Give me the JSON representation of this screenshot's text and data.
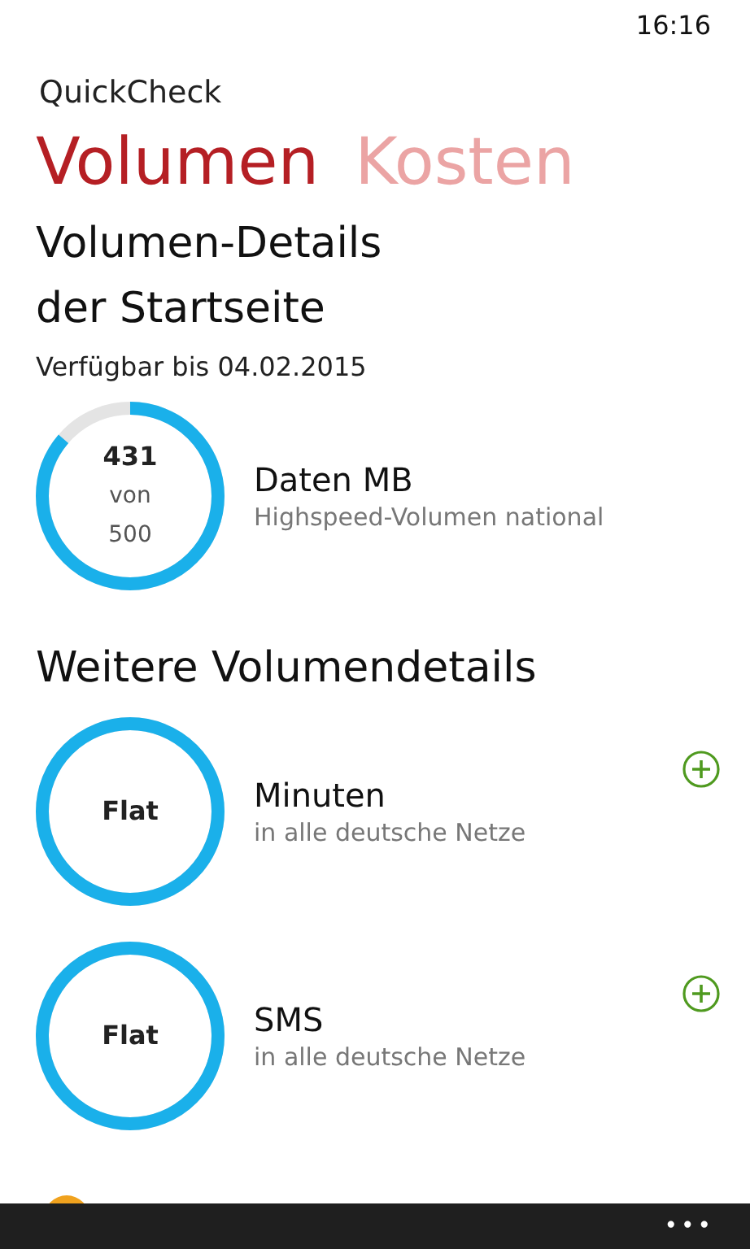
{
  "status_bar": {
    "time": "16:16"
  },
  "app_title": "QuickCheck",
  "pivots": [
    {
      "label": "Volumen",
      "selected": true
    },
    {
      "label": "Kosten",
      "selected": false
    }
  ],
  "heading_lines": [
    "Volumen-Details",
    "der Startseite"
  ],
  "valid_until": "Verfügbar bis 04.02.2015",
  "main_items": [
    {
      "kind": "counter",
      "center": [
        "431",
        "von",
        "500"
      ],
      "title": "Daten MB",
      "subtitle": "Highspeed-Volumen national",
      "has_add": false
    }
  ],
  "more_title": "Weitere Volumendetails",
  "more_items": [
    {
      "kind": "flat",
      "center": [
        "Flat"
      ],
      "title": "Minuten",
      "subtitle": "in alle deutsche Netze",
      "has_add": true
    },
    {
      "kind": "flat",
      "center": [
        "Flat"
      ],
      "title": "SMS",
      "subtitle": "in alle deutsche Netze",
      "has_add": true
    }
  ],
  "app_bar": {
    "menu": "•••"
  }
}
